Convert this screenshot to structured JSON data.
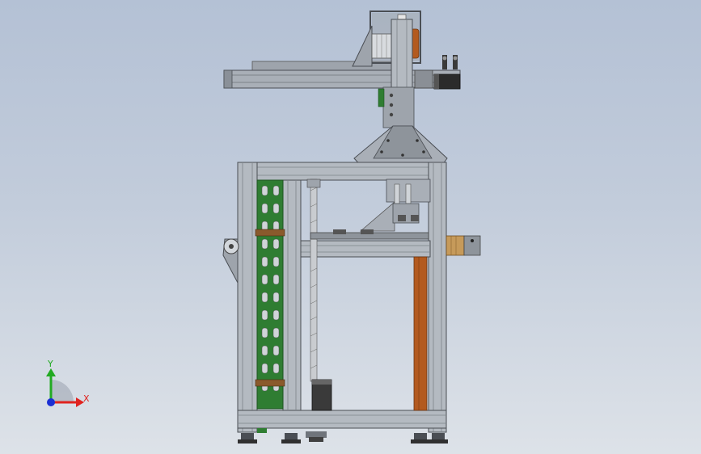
{
  "view": {
    "background_top": "#b4c1d5",
    "background_bottom": "#dde2e8",
    "colors": {
      "aluminum": "#a9afb7",
      "aluminum_dark": "#6f747b",
      "aluminum_light": "#d3d7dc",
      "pcb_green": "#2f7d32",
      "pcb_green_dark": "#1d5420",
      "copper": "#b35a1f",
      "motor_dark": "#2b2b2b",
      "wood_tan": "#c69a5a",
      "foot_dark": "#303030"
    }
  },
  "triad": {
    "x_label": "X",
    "y_label": "Y",
    "x_color": "#e0231f",
    "y_color": "#22aa22",
    "z_color": "#1b2fd4"
  }
}
